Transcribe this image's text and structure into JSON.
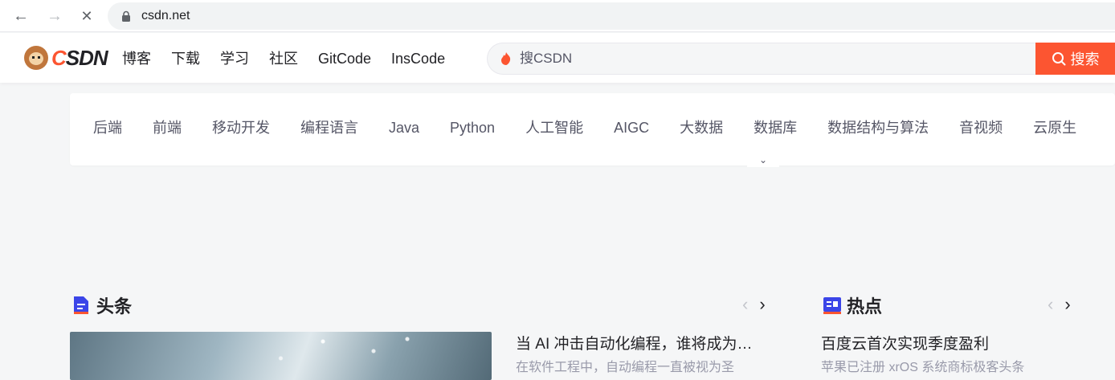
{
  "browser": {
    "url": "csdn.net",
    "back_glyph": "←",
    "forward_glyph": "→",
    "stop_glyph": "✕"
  },
  "header": {
    "logo_c": "C",
    "logo_rest": "SDN",
    "nav": [
      "博客",
      "下载",
      "学习",
      "社区",
      "GitCode",
      "InsCode"
    ],
    "search_placeholder": "搜CSDN",
    "search_button": "搜索"
  },
  "categories": {
    "items": [
      "后端",
      "前端",
      "移动开发",
      "编程语言",
      "Java",
      "Python",
      "人工智能",
      "AIGC",
      "大数据",
      "数据库",
      "数据结构与算法",
      "音视频",
      "云原生"
    ],
    "expand_glyph": "⌄"
  },
  "headlines": {
    "title": "头条",
    "prev_glyph": "‹",
    "next_glyph": "›",
    "article_title": "当 AI 冲击自动化编程，谁将成为…",
    "article_desc": "在软件工程中，自动编程一直被视为圣"
  },
  "hot": {
    "title": "热点",
    "prev_glyph": "‹",
    "next_glyph": "›",
    "article_title": "百度云首次实现季度盈利",
    "article_desc": "苹果已注册 xrOS 系统商标极客头条"
  },
  "colors": {
    "brand": "#fc5531",
    "icon_blue": "#3b45e8"
  }
}
